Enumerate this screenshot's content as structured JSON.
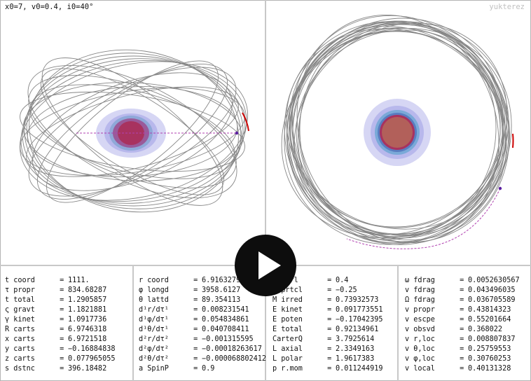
{
  "header": {
    "params": "x0=7, v0=0.4, i0=40°",
    "watermark": "yukterez"
  },
  "col1": [
    {
      "label": "t coord",
      "value": "1111."
    },
    {
      "label": "τ propr",
      "value": "834.68287"
    },
    {
      "label": "t total",
      "value": "1.2905857"
    },
    {
      "label": "ς gravt",
      "value": "1.1821881"
    },
    {
      "label": "γ kinet",
      "value": "1.0917736"
    },
    {
      "label": "R carts",
      "value": "6.9746318"
    },
    {
      "label": "x carts",
      "value": "6.9721518"
    },
    {
      "label": "y carts",
      "value": "−0.16884838"
    },
    {
      "label": "z carts",
      "value": "0.077965055"
    },
    {
      "label": "s dstnc",
      "value": "396.18482"
    }
  ],
  "col2": [
    {
      "label": "r coord",
      "value": "6.9163279"
    },
    {
      "label": "φ longd",
      "value": "3958.6127"
    },
    {
      "label": "θ lattd",
      "value": "89.354113"
    },
    {
      "label": "d¹r/dτ¹",
      "value": "0.008231541"
    },
    {
      "label": "d¹φ/dτ¹",
      "value": "0.054834861"
    },
    {
      "label": "d¹θ/dτ¹",
      "value": "0.040708411"
    },
    {
      "label": "d²r/dτ²",
      "value": "−0.001315595"
    },
    {
      "label": "d²φ/dτ²",
      "value": "−0.00018263617"
    },
    {
      "label": "d²θ/dτ²",
      "value": "−0.000068802412"
    },
    {
      "label": "a SpinP",
      "value": "0.9"
    }
  ],
  "col3": [
    {
      "label": "Q ctrl",
      "value": "0.4"
    },
    {
      "label": "Q prtcl",
      "value": "−0.25"
    },
    {
      "label": "M irred",
      "value": "0.73932573"
    },
    {
      "label": "E kinet",
      "value": "0.091773551"
    },
    {
      "label": "E poten",
      "value": "−0.17042395"
    },
    {
      "label": "E total",
      "value": "0.92134961"
    },
    {
      "label": "CarterQ",
      "value": "3.7925614"
    },
    {
      "label": "L axial",
      "value": "2.3349163"
    },
    {
      "label": "L polar",
      "value": "1.9617383"
    },
    {
      "label": "p r.mom",
      "value": "0.011244919"
    }
  ],
  "col4": [
    {
      "label": "ω fdrag",
      "value": "0.0052630567"
    },
    {
      "label": "v fdrag",
      "value": "0.043496035"
    },
    {
      "label": "Ω fdrag",
      "value": "0.036705589"
    },
    {
      "label": "v propr",
      "value": "0.43814323"
    },
    {
      "label": "v escpe",
      "value": "0.55201664"
    },
    {
      "label": "v obsvd",
      "value": "0.368022"
    },
    {
      "label": "v r,loc",
      "value": "0.008807837"
    },
    {
      "label": "v θ,loc",
      "value": "0.25759553"
    },
    {
      "label": "v φ,loc",
      "value": "0.30760253"
    },
    {
      "label": "v local",
      "value": "0.40131328"
    }
  ],
  "colors": {
    "orbit": "#7a7a7a",
    "trail": "#b040b0",
    "particle": "#cc0000",
    "ergo": "#8f8fe0",
    "horizon": "#a0305a",
    "play": "#0d0d0d"
  },
  "icons": {
    "play": "play-icon"
  }
}
